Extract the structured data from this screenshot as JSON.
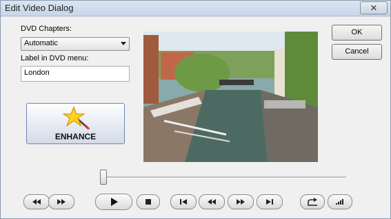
{
  "window": {
    "title": "Edit Video Dialog",
    "close_glyph": "✕"
  },
  "chapters": {
    "label": "DVD Chapters:",
    "selected": "Automatic"
  },
  "menu_label": {
    "label": "Label in DVD menu:",
    "value": "London"
  },
  "enhance": {
    "label": "ENHANCE",
    "icon": "magic-wand-star-icon"
  },
  "preview": {
    "icon": "video-frame"
  },
  "buttons": {
    "ok": "OK",
    "cancel": "Cancel"
  },
  "timeline": {
    "position": 0.01
  },
  "controls": [
    "rewind-icon",
    "fast-forward-icon",
    "play-icon",
    "stop-icon",
    "skip-to-start-icon",
    "step-back-icon",
    "step-forward-icon",
    "skip-to-end-icon",
    "share-icon",
    "volume-icon"
  ]
}
